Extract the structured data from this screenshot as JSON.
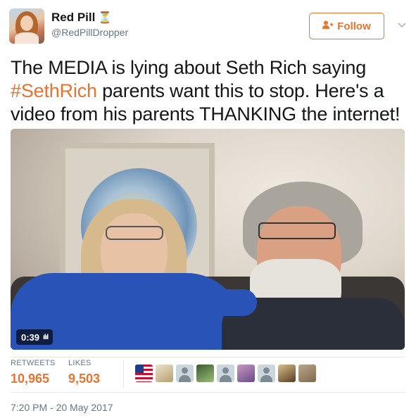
{
  "user": {
    "name": "Red Pill",
    "name_emoji": "⏳",
    "handle": "@RedPillDropper"
  },
  "follow_button": {
    "label": "Follow",
    "icon": "add-user-icon"
  },
  "tweet": {
    "text_before": "The MEDIA is lying about Seth Rich saying ",
    "hashtag": "#SethRich",
    "text_after": " parents want this to stop. Here's a video from his parents THANKING the internet!"
  },
  "video": {
    "duration": "0:39",
    "indicator": "ılıl"
  },
  "stats": {
    "retweets_label": "RETWEETS",
    "retweets_value": "10,965",
    "likes_label": "LIKES",
    "likes_value": "9,503"
  },
  "likers": [
    "flag",
    "photo1",
    "default",
    "photo2",
    "default",
    "photo3",
    "default",
    "photo4",
    "photo5"
  ],
  "timestamp": "7:20 PM - 20 May 2017",
  "colors": {
    "accent": "#e8742f",
    "muted": "#657786",
    "divider": "#e1e8ed"
  }
}
